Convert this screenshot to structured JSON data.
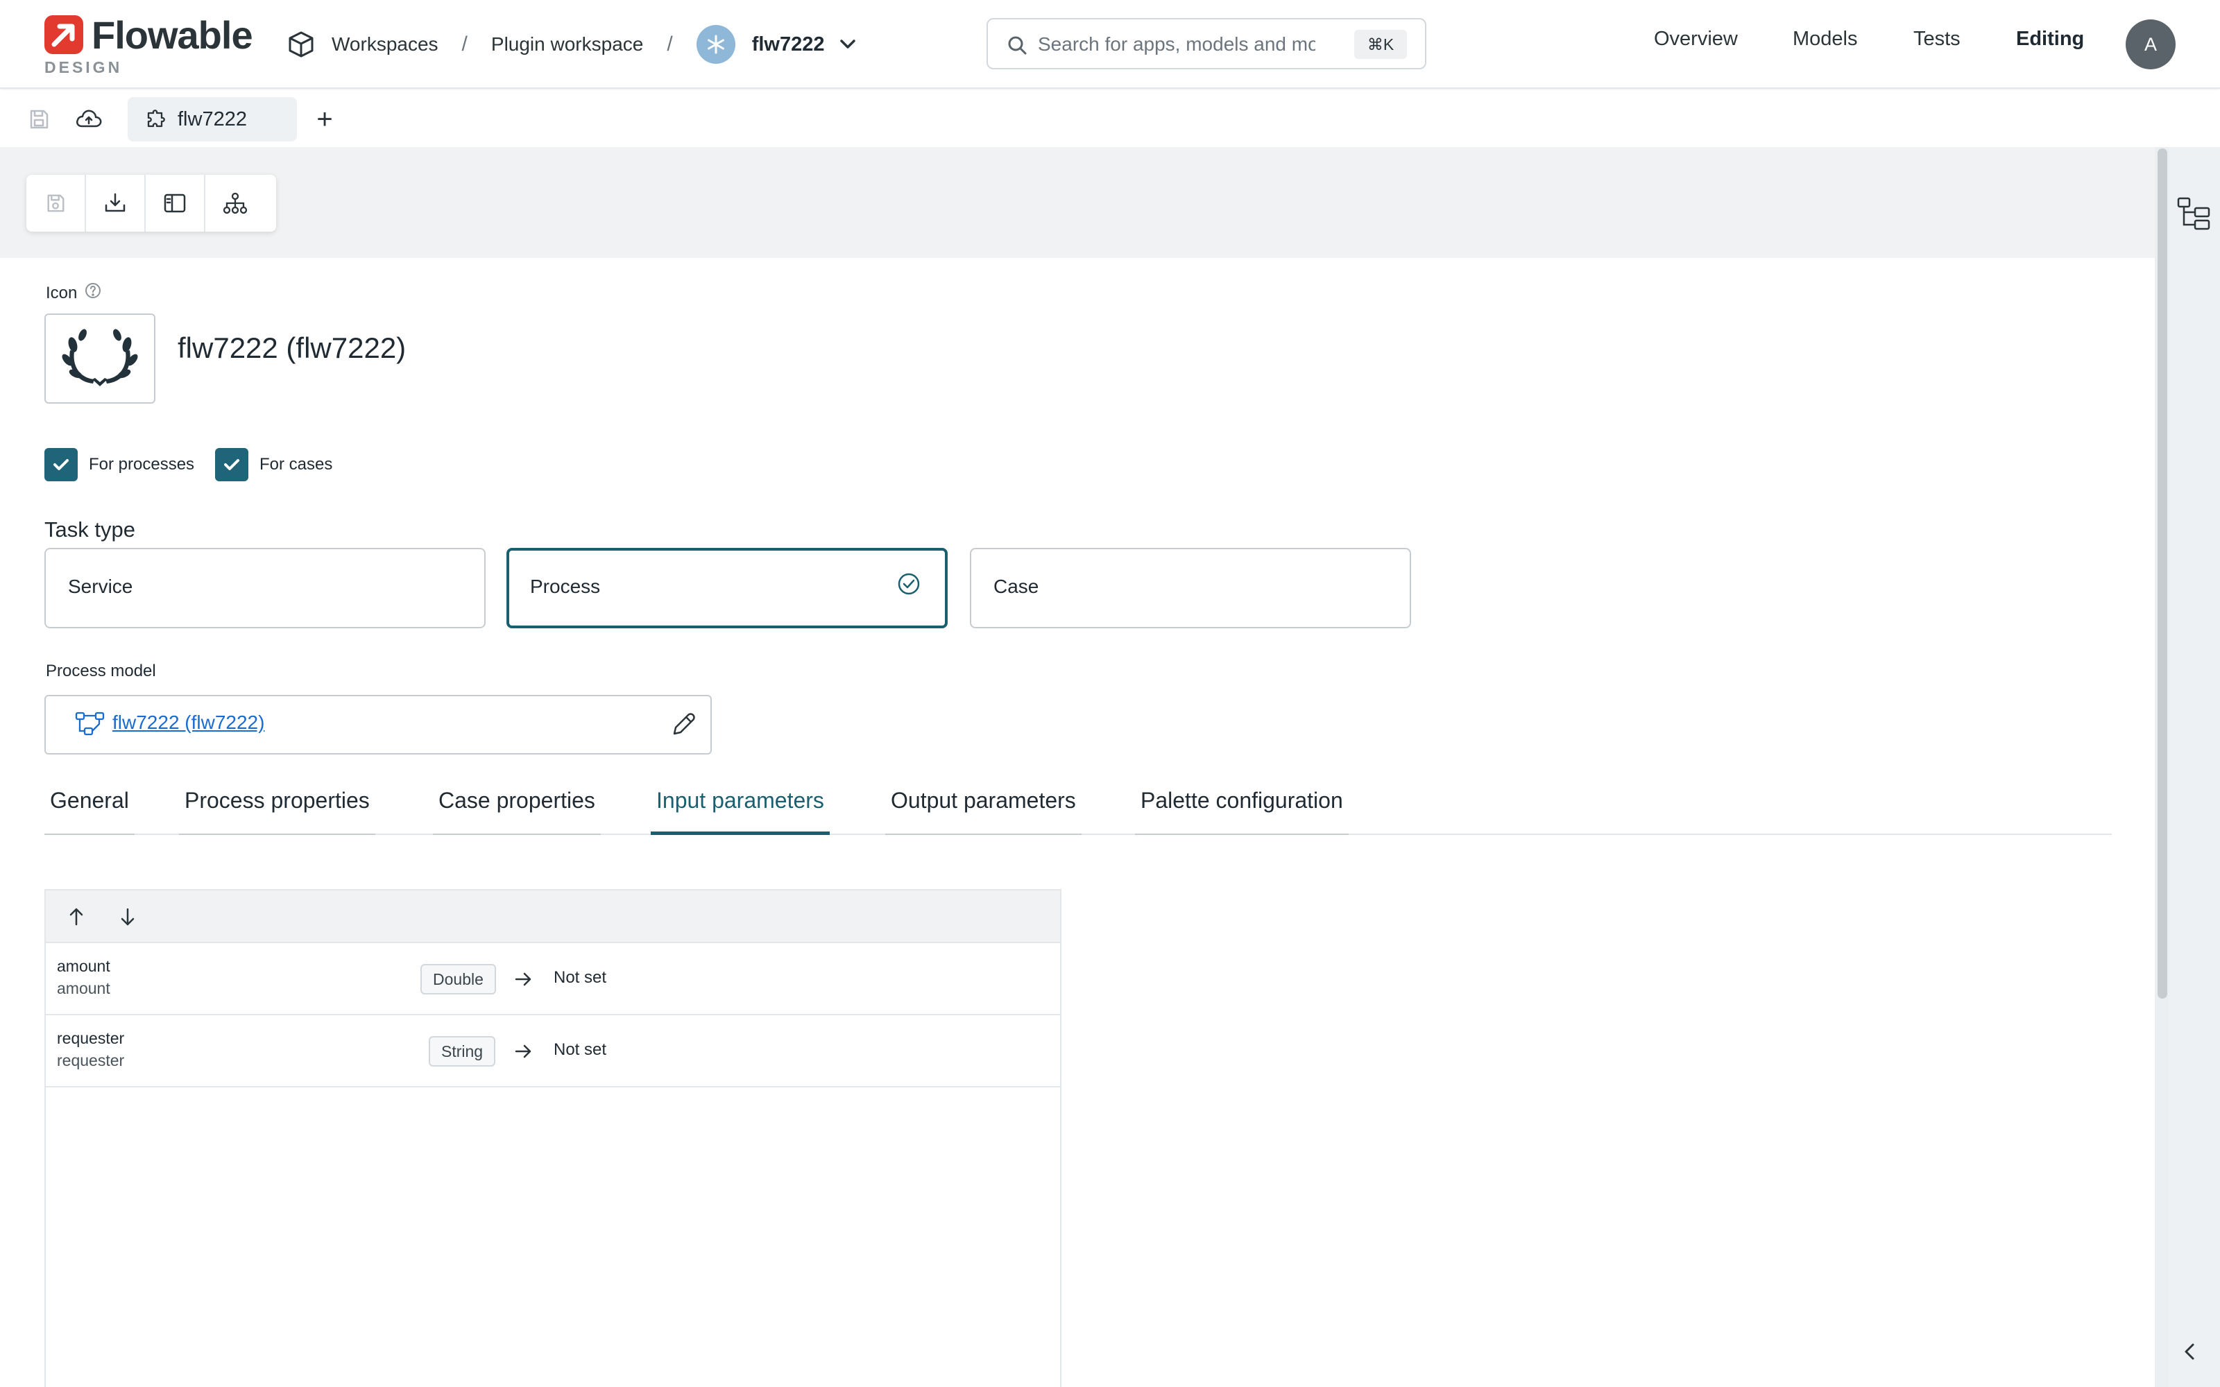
{
  "header": {
    "logo_word": "Flowable",
    "logo_sub": "DESIGN",
    "breadcrumbs": {
      "workspaces": "Workspaces",
      "separator": "/",
      "plugin_workspace": "Plugin workspace",
      "app": "flw7222"
    },
    "search": {
      "placeholder": "Search for apps, models and more",
      "shortcut": "⌘K"
    },
    "nav": {
      "overview": "Overview",
      "models": "Models",
      "tests": "Tests",
      "editing": "Editing"
    },
    "user_initial": "A"
  },
  "tabstrip": {
    "open_tab": "flw7222",
    "add_label": "+"
  },
  "form": {
    "icon_label": "Icon",
    "title": "flw7222 (flw7222)",
    "checkboxes": {
      "for_processes": {
        "label": "For processes",
        "checked": true
      },
      "for_cases": {
        "label": "For cases",
        "checked": true
      }
    },
    "task_type": {
      "label": "Task type",
      "options": [
        "Service",
        "Process",
        "Case"
      ],
      "selected": "Process"
    },
    "process_model": {
      "label": "Process model",
      "value": "flw7222 (flw7222)"
    }
  },
  "tabs": {
    "general": "General",
    "process_properties": "Process properties",
    "case_properties": "Case properties",
    "input_parameters": "Input parameters",
    "output_parameters": "Output parameters",
    "palette_configuration": "Palette configuration",
    "active": "Input parameters"
  },
  "parameters": [
    {
      "name": "amount",
      "id": "amount",
      "type": "Double",
      "mapping": "Not set"
    },
    {
      "name": "requester",
      "id": "requester",
      "type": "String",
      "mapping": "Not set"
    }
  ],
  "colors": {
    "accent": "#1a5f70",
    "checkbox": "#1f6479",
    "link": "#1a6bd1",
    "logo": "#e23a2f",
    "app_avatar": "#8fb8d8"
  },
  "icons": {
    "workspace": "cube-icon",
    "app": "asterisk-icon",
    "search": "search-icon",
    "save": "save-icon",
    "publish": "cloud-upload-icon",
    "plugin": "puzzle-icon",
    "download": "download-icon",
    "sidebar": "sidebar-layout-icon",
    "hierarchy": "hierarchy-icon",
    "laurel": "laurel-wreath-icon",
    "help": "help-circle-icon",
    "check": "check-icon",
    "process": "process-model-icon",
    "edit": "pencil-icon",
    "move_up": "arrow-up-icon",
    "move_down": "arrow-down-icon",
    "mapping": "arrow-right-icon",
    "rail": "tree-structure-icon",
    "collapse": "chevron-left-icon"
  }
}
